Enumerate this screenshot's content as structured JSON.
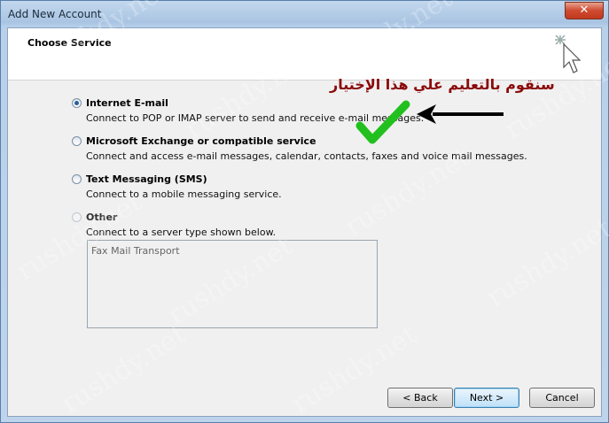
{
  "window": {
    "title": "Add New Account",
    "close_label": "✕"
  },
  "header": {
    "title": "Choose Service"
  },
  "options": [
    {
      "label": "Internet E-mail",
      "description": "Connect to POP or IMAP server to send and receive e-mail messages.",
      "selected": true
    },
    {
      "label": "Microsoft Exchange or compatible service",
      "description": "Connect and access e-mail messages, calendar, contacts, faxes and voice mail messages.",
      "selected": false
    },
    {
      "label": "Text Messaging (SMS)",
      "description": "Connect to a mobile messaging service.",
      "selected": false
    },
    {
      "label": "Other",
      "description": "Connect to a server type shown below.",
      "selected": false
    }
  ],
  "other_list": {
    "items": [
      "Fax Mail Transport"
    ]
  },
  "buttons": {
    "back": "< Back",
    "next": "Next >",
    "cancel": "Cancel"
  },
  "annotation": {
    "text": "سنقوم بالتعليم علي هذا الإختيار"
  },
  "watermark": {
    "text": "rushdy.net"
  },
  "colors": {
    "accent": "#2c5f9a",
    "annotation": "#8b0a0a",
    "checkmark": "#22c01e"
  }
}
